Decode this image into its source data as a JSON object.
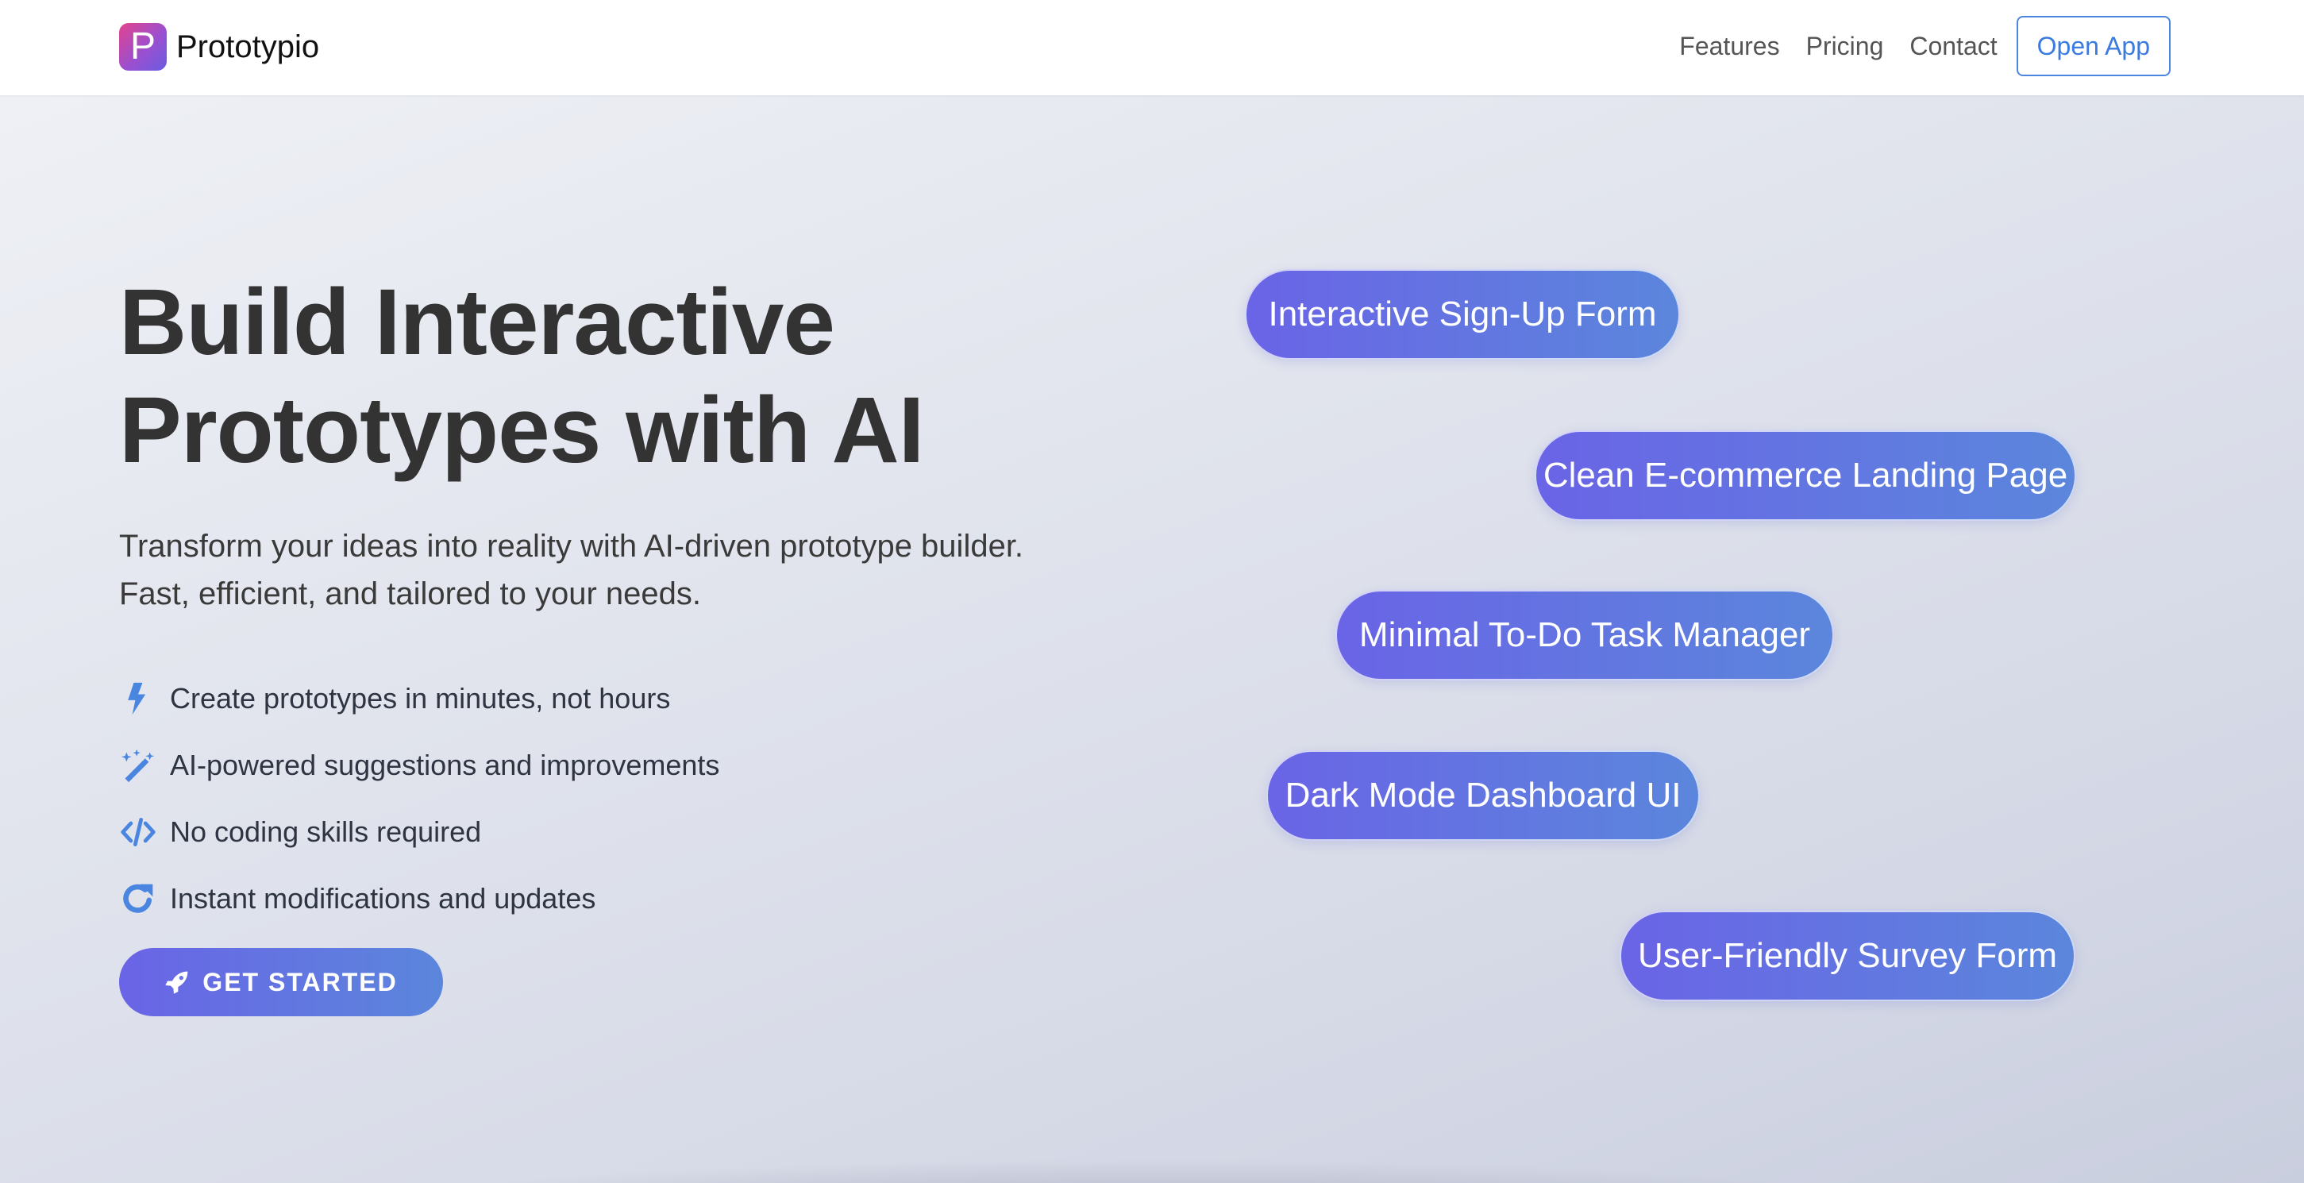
{
  "navbar": {
    "brand_logo_letter": "P",
    "brand_name": "Prototypio",
    "links": [
      "Features",
      "Pricing",
      "Contact"
    ],
    "open_app_label": "Open App"
  },
  "hero": {
    "title_line1": "Build Interactive",
    "title_line2": "Prototypes with AI",
    "subtitle_line1": "Transform your ideas into reality with AI-driven prototype builder.",
    "subtitle_line2": "Fast, efficient, and tailored to your needs.",
    "features": [
      {
        "icon": "bolt-icon",
        "text": "Create prototypes in minutes, not hours"
      },
      {
        "icon": "magic-wand-icon",
        "text": "AI-powered suggestions and improvements"
      },
      {
        "icon": "code-icon",
        "text": "No coding skills required"
      },
      {
        "icon": "refresh-icon",
        "text": "Instant modifications and updates"
      }
    ],
    "cta_label": "GET STARTED",
    "cta_icon": "rocket-icon"
  },
  "examples": [
    "Interactive Sign-Up Form",
    "Clean E-commerce Landing Page",
    "Minimal To-Do Task Manager",
    "Dark Mode Dashboard UI",
    "User-Friendly Survey Form"
  ],
  "colors": {
    "accent": "#5b86dc",
    "gradient_start": "#6a64e6",
    "gradient_end": "#5b86dc",
    "icon": "#4a86e0",
    "logo_gradient": [
      "#e4438c",
      "#9b4fd0",
      "#6a5ce0"
    ]
  }
}
